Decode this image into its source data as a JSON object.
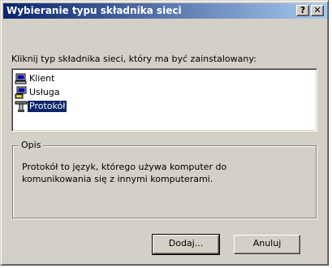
{
  "window": {
    "title": "Wybieranie typu składnika sieci",
    "help_label": "?",
    "close_label": "✕"
  },
  "prompt": "Kliknij typ składnika sieci, który ma być zainstalowany:",
  "list": {
    "items": [
      {
        "label": "Klient",
        "icon": "client-computer-icon"
      },
      {
        "label": "Usługa",
        "icon": "service-icon"
      },
      {
        "label": "Protokół",
        "icon": "protocol-icon",
        "selected": true
      }
    ]
  },
  "description": {
    "group_label": "Opis",
    "text": "Protokół to język, którego używa komputer do komunikowania się z innymi komputerami."
  },
  "buttons": {
    "add_label": "Dodaj...",
    "cancel_label": "Anuluj"
  },
  "colors": {
    "title_start": "#0a246a",
    "title_end": "#a6caf0",
    "face": "#d4d0c8",
    "selection": "#0a246a"
  }
}
